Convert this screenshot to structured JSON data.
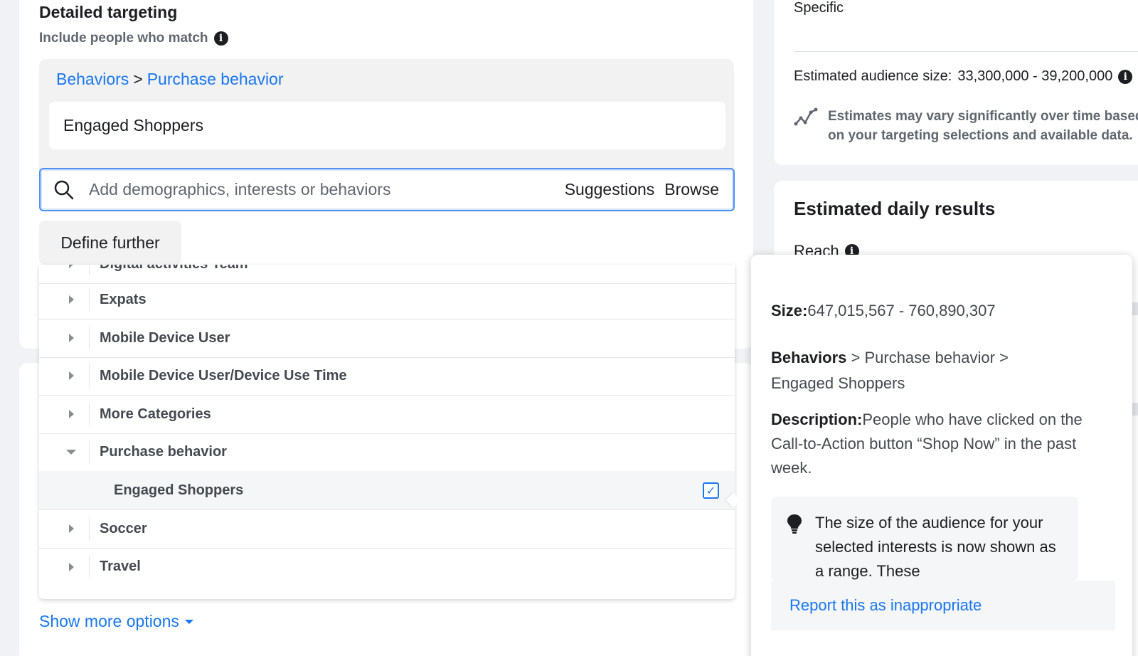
{
  "targeting": {
    "title": "Detailed targeting",
    "include_label": "Include people who match",
    "breadcrumb": {
      "level1": "Behaviors",
      "sep": ">",
      "level2": "Purchase behavior"
    },
    "selected_item": "Engaged Shoppers",
    "search": {
      "placeholder": "Add demographics, interests or behaviors",
      "suggestions_label": "Suggestions",
      "browse_label": "Browse"
    },
    "define_further_label": "Define further",
    "show_more_label": "Show more options"
  },
  "dropdown": {
    "items": [
      {
        "label": "Digital activities Team",
        "expanded": false
      },
      {
        "label": "Expats",
        "expanded": false
      },
      {
        "label": "Mobile Device User",
        "expanded": false
      },
      {
        "label": "Mobile Device User/Device Use Time",
        "expanded": false
      },
      {
        "label": "More Categories",
        "expanded": false
      },
      {
        "label": "Purchase behavior",
        "expanded": true
      },
      {
        "label": "Engaged Shoppers",
        "child": true,
        "checked": true
      },
      {
        "label": "Soccer",
        "expanded": false
      },
      {
        "label": "Travel",
        "expanded": false
      }
    ]
  },
  "audience": {
    "specific_label": "Specific",
    "size_label": "Estimated audience size:",
    "size_value": "33,300,000 - 39,200,000",
    "note": "Estimates may vary significantly over time based on your targeting selections and available data."
  },
  "daily": {
    "title": "Estimated daily results",
    "reach_label": "Reach"
  },
  "popover": {
    "size_label": "Size:",
    "size_value": "647,015,567 - 760,890,307",
    "path_bold": "Behaviors",
    "path_rest": " > Purchase behavior > Engaged Shoppers",
    "desc_label": "Description:",
    "desc_value": "People who have clicked on the Call-to-Action button “Shop Now” in the past week.",
    "hint": "The size of the audience for your selected interests is now shown as a range. These",
    "report_label": "Report this as inappropriate"
  },
  "colors": {
    "link": "#1877f2",
    "background": "#f0f2f5",
    "focus_border": "#4d8ff5"
  }
}
